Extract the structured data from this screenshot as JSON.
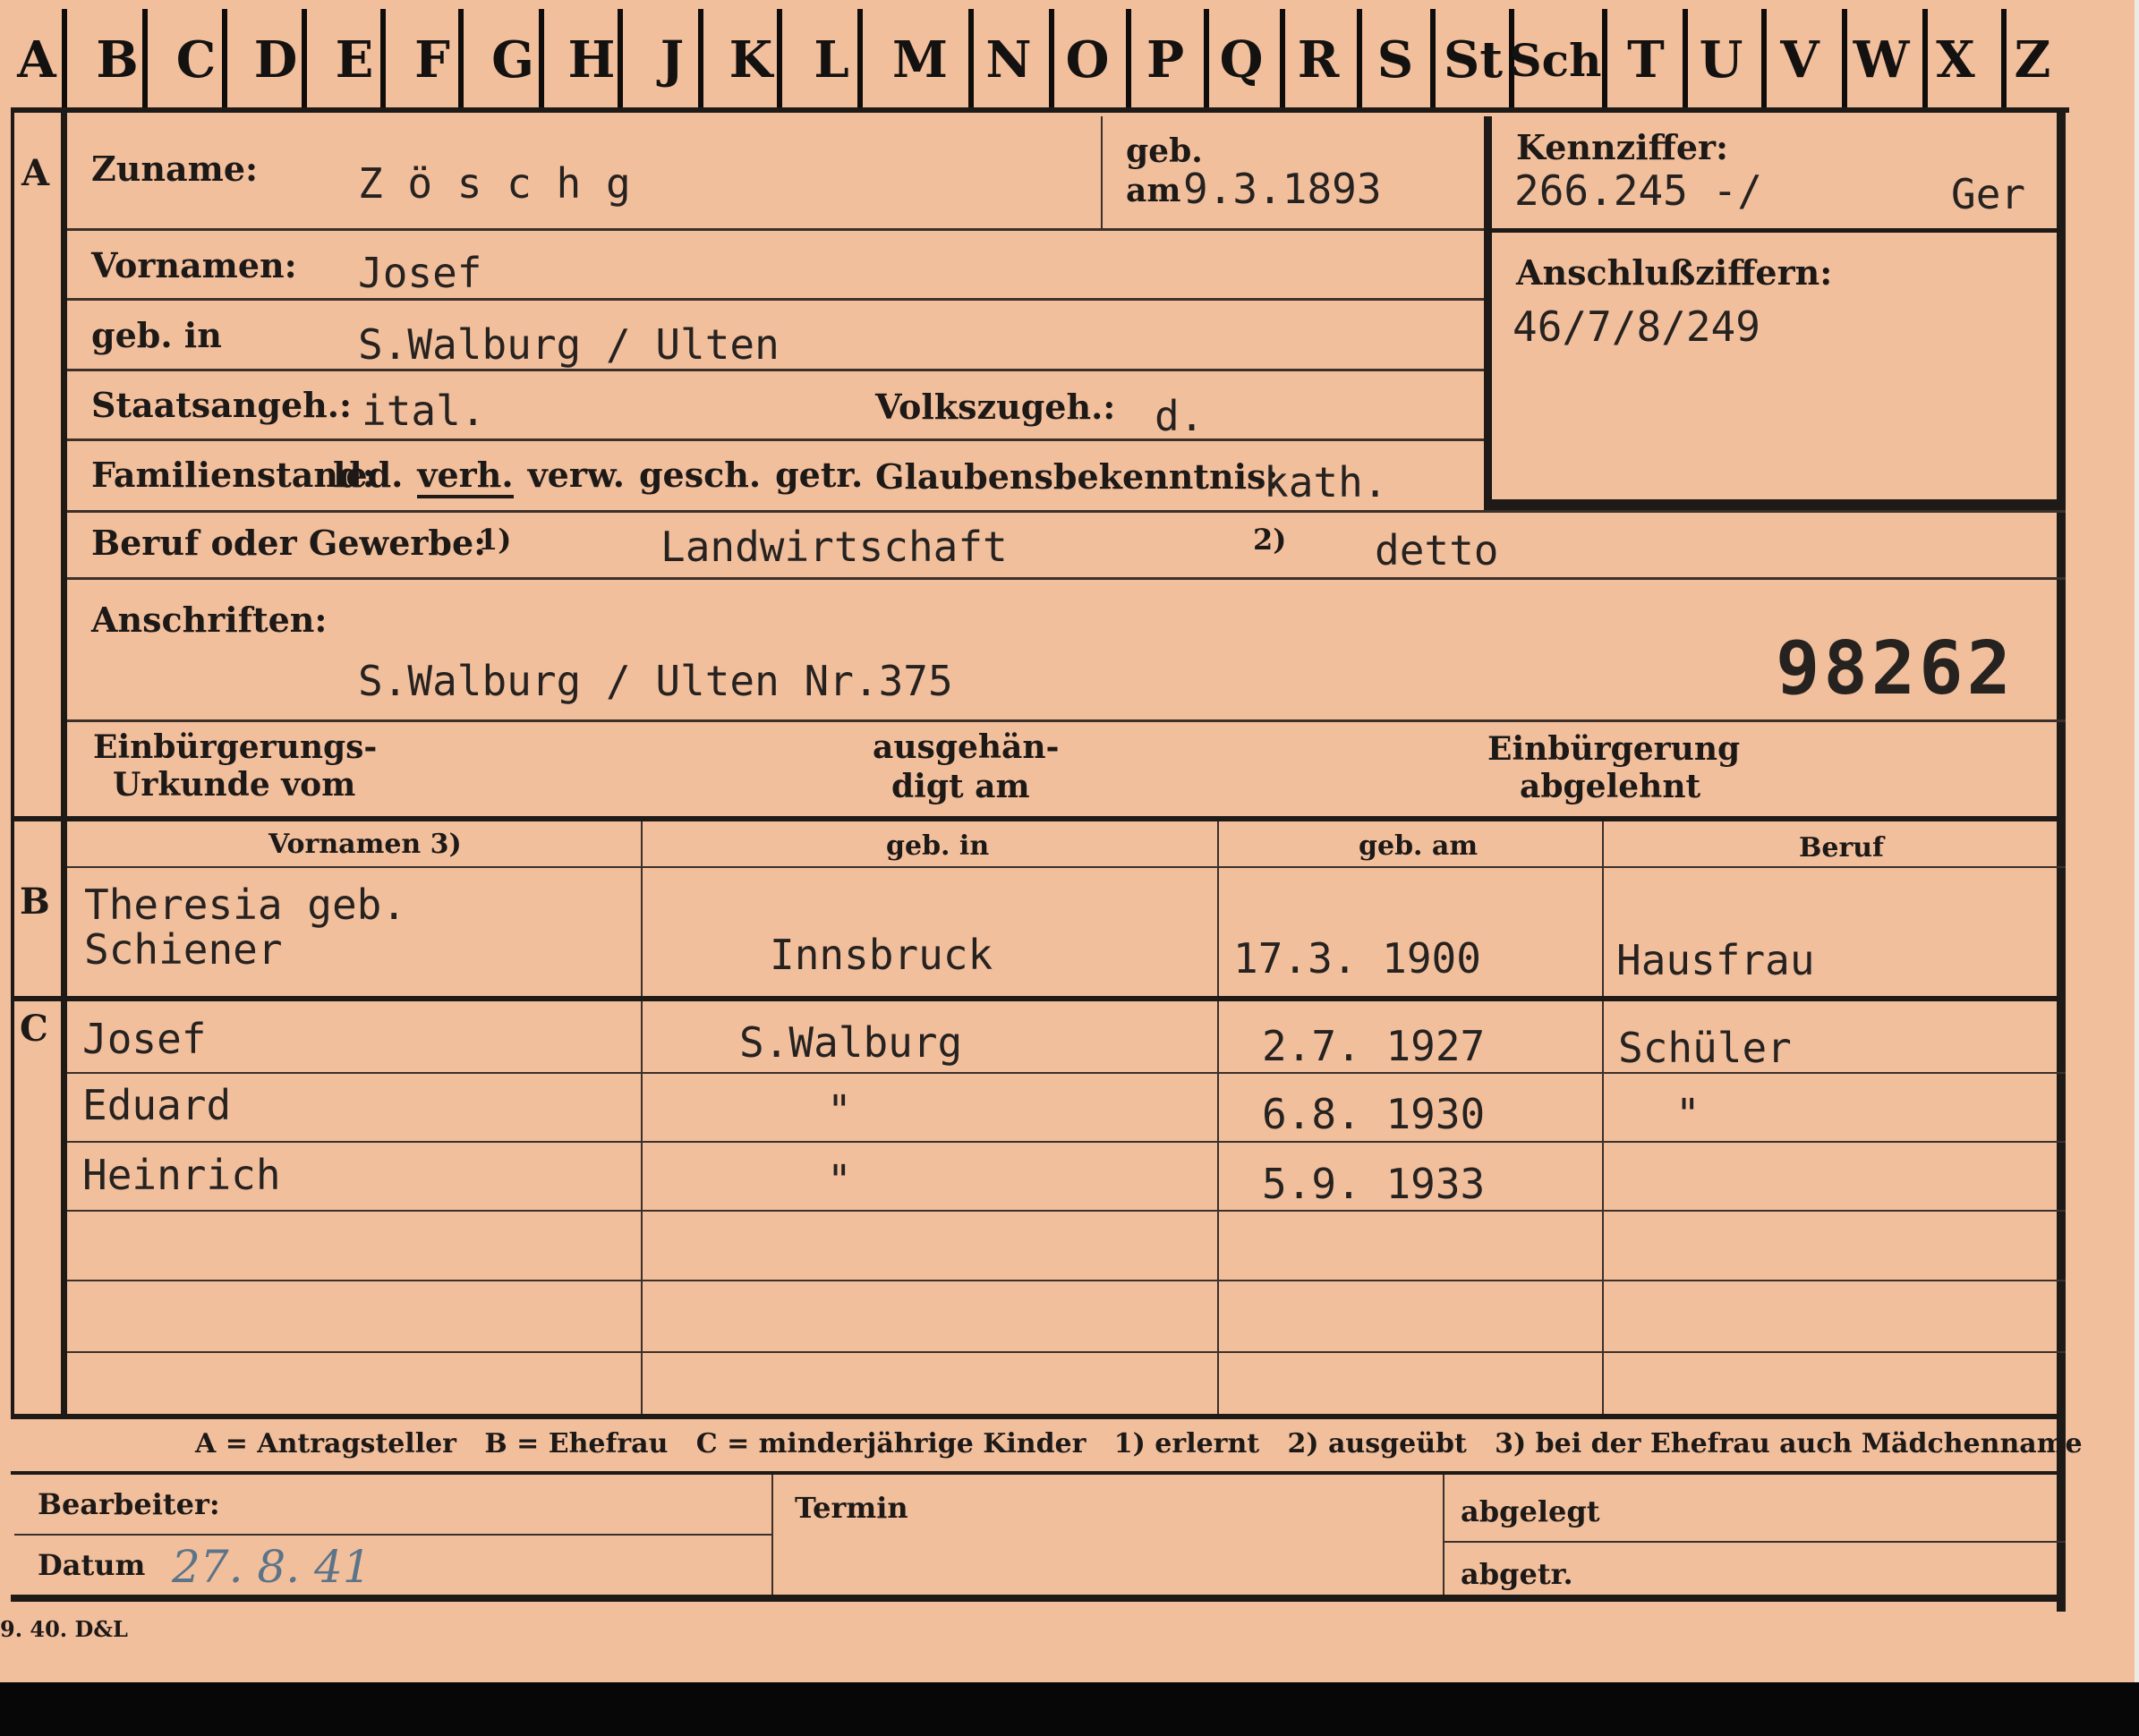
{
  "alphabet_tabs": [
    "A",
    "B",
    "C",
    "D",
    "E",
    "F",
    "G",
    "H",
    "J",
    "K",
    "L",
    "M",
    "N",
    "O",
    "P",
    "Q",
    "R",
    "S",
    "St",
    "Sch",
    "T",
    "U",
    "V",
    "W",
    "X",
    "Z"
  ],
  "sections": {
    "a": "A",
    "b": "B",
    "c": "C"
  },
  "applicant": {
    "surname_label": "Zuname:",
    "surname": "Z ö s c h g",
    "born_label_1": "geb.",
    "born_label_2": "am",
    "birth_date": "9.3.1893",
    "first_names_label": "Vornamen:",
    "first_names": "Josef",
    "birthplace_label": "geb. in",
    "birthplace": "S.Walburg / Ulten",
    "nationality_label": "Staatsangeh.:",
    "nationality": "ital.",
    "ethnicity_label": "Volkszugeh.:",
    "ethnicity": "d.",
    "marital_label": "Familienstand:",
    "marital_options": [
      "led.",
      "verh.",
      "verw.",
      "gesch.",
      "getr."
    ],
    "marital_selected": "verh.",
    "religion_label": "Glaubensbekenntnis:",
    "religion": "kath.",
    "occupation_label": "Beruf oder Gewerbe:",
    "occupation_learned_marker": "1)",
    "occupation_learned": "Landwirtschaft",
    "occupation_practised_marker": "2)",
    "occupation_practised": "detto",
    "addresses_label": "Anschriften:",
    "address": "S.Walburg / Ulten Nr.375",
    "file_number": "98262",
    "naturalization_cert_label_1": "Einbürgerungs-",
    "naturalization_cert_label_2": "Urkunde vom",
    "handed_over_label_1": "ausgehän-",
    "handed_over_label_2": "digt am",
    "naturalization_refused_label_1": "Einbürgerung",
    "naturalization_refused_label_2": "abgelehnt"
  },
  "identifiers": {
    "code_label": "Kennziffer:",
    "code": "266.245 -/",
    "code_suffix": "Ger",
    "link_codes_label": "Anschlußziffern:",
    "link_codes": "46/7/8/249"
  },
  "family_table": {
    "headers": [
      "Vornamen 3)",
      "geb. in",
      "geb. am",
      "Beruf"
    ],
    "spouse": {
      "first_name_line1": "Theresia geb.",
      "first_name_line2": "Schiener",
      "birthplace": "Innsbruck",
      "birth_date": "17.3. 1900",
      "occupation": "Hausfrau"
    },
    "children": [
      {
        "first_name": "Josef",
        "birthplace": "S.Walburg",
        "birth_date": "2.7. 1927",
        "occupation": "Schüler"
      },
      {
        "first_name": "Eduard",
        "birthplace": "\"",
        "birth_date": "6.8. 1930",
        "occupation": "\""
      },
      {
        "first_name": "Heinrich",
        "birthplace": "\"",
        "birth_date": "5.9. 1933",
        "occupation": ""
      }
    ]
  },
  "legend": "A = Antragsteller   B = Ehefrau   C = minderjährige Kinder   1) erlernt   2) ausgeübt   3) bei der Ehefrau auch Mädchenname",
  "footer": {
    "clerk_label": "Bearbeiter:",
    "date_label": "Datum",
    "date_value": "27. 8. 41",
    "appointment_label": "Termin",
    "filed_label": "abgelegt",
    "removed_label": "abgetr."
  },
  "print_code": "9. 40. D&L",
  "colors": {
    "card": "#f2bf9d",
    "ink": "#1e1a17",
    "pencil": "#5b7488"
  }
}
